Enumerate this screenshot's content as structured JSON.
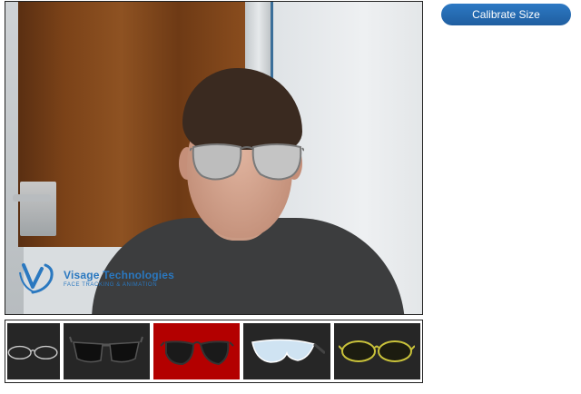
{
  "calibrate_label": "Calibrate Size",
  "logo": {
    "name": "Visage Technologies",
    "tagline": "FACE TRACKING & ANIMATION"
  },
  "frames": [
    {
      "icon": "thin-wire-glasses-icon",
      "selected": false
    },
    {
      "icon": "black-sport-sunglasses-icon",
      "selected": false
    },
    {
      "icon": "aviator-sunglasses-icon",
      "selected": true
    },
    {
      "icon": "white-shield-sunglasses-icon",
      "selected": false
    },
    {
      "icon": "gold-wire-sunglasses-icon",
      "selected": false
    }
  ],
  "colors": {
    "accent": "#1f5ea0",
    "selected_thumb": "#b30000",
    "thumb_bg": "#262626",
    "logo": "#2a78c0"
  }
}
